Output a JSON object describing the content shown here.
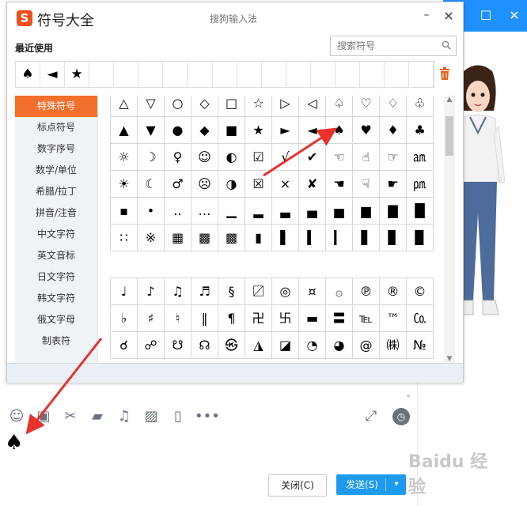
{
  "panel": {
    "title": "符号大全",
    "subtitle": "搜狗输入法",
    "logo": "S",
    "minimize": "–",
    "close": "✕",
    "recent_label": "最近使用",
    "search_placeholder": "搜索符号",
    "recent": [
      "♠",
      "◄",
      "★"
    ],
    "recent_empty_count": 14,
    "categories": [
      "特殊符号",
      "标点符号",
      "数字序号",
      "数学/单位",
      "希腊/拉丁",
      "拼音/注音",
      "中文字符",
      "英文音标",
      "日文字符",
      "韩文字符",
      "俄文字母",
      "制表符"
    ],
    "active_category": 0,
    "grid_top": [
      "△",
      "▽",
      "○",
      "◇",
      "□",
      "☆",
      "▷",
      "◁",
      "♤",
      "♡",
      "♢",
      "♧",
      "▲",
      "▼",
      "●",
      "◆",
      "■",
      "★",
      "►",
      "◄",
      "♠",
      "♥",
      "♦",
      "♣",
      "☼",
      "☽",
      "♀",
      "☺",
      "◐",
      "☑",
      "√",
      "✔",
      "☜",
      "☝",
      "☞",
      "㏂",
      "☀",
      "☾",
      "♂",
      "☹",
      "◑",
      "☒",
      "×",
      "✘",
      "☚",
      "☟",
      "☛",
      "㏘",
      "▪",
      "•",
      "‥",
      "…",
      "▁",
      "▂",
      "▃",
      "▄",
      "▅",
      "▆",
      "▇",
      "█",
      "∷",
      "※",
      "▦",
      "▩",
      "▩",
      "▮",
      "▌",
      "▍",
      "▎",
      "▋",
      "▊",
      "▉"
    ],
    "grid_bottom": [
      "♩",
      "♪",
      "♫",
      "♬",
      "§",
      "〼",
      "◎",
      "¤",
      "۞",
      "℗",
      "®",
      "©",
      "♭",
      "♯",
      "♮",
      "‖",
      "¶",
      "卍",
      "卐",
      "▬",
      "〓",
      "℡",
      "™",
      "㏇",
      "☌",
      "☍",
      "☋",
      "☊",
      "㉿",
      "◮",
      "◪",
      "◔",
      "◕",
      "@",
      "㈱",
      "№"
    ]
  },
  "toolbar": {
    "icons": [
      "smile-icon",
      "screenshot-icon",
      "scissors-icon",
      "folder-icon",
      "music-icon",
      "image-icon",
      "shake-icon",
      "more-icon"
    ],
    "glyphs": [
      "☺",
      "▣",
      "✂",
      "▰",
      "♫",
      "▨",
      "▯",
      "•••"
    ],
    "expand": "⤢",
    "history": "◷",
    "collapse": "⌄"
  },
  "message": {
    "content": "♠"
  },
  "buttons": {
    "close_label": "关闭(C)",
    "send_label": "发送(S)",
    "send_dropdown": "▾"
  },
  "window_controls": [
    "–",
    "☐",
    "✕"
  ],
  "watermark": "Baidu 经验"
}
